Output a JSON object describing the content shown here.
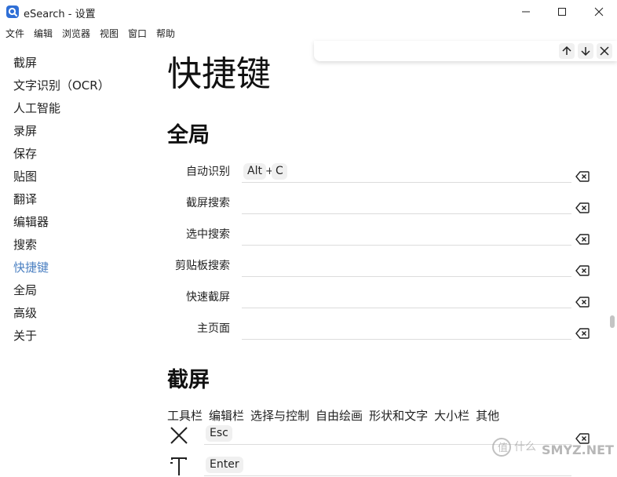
{
  "window": {
    "title": "eSearch - 设置"
  },
  "menubar": [
    "文件",
    "编辑",
    "浏览器",
    "视图",
    "窗口",
    "帮助"
  ],
  "sidebar": {
    "items": [
      "截屏",
      "文字识别（OCR）",
      "人工智能",
      "录屏",
      "保存",
      "贴图",
      "翻译",
      "编辑器",
      "搜索",
      "快捷键",
      "全局",
      "高级",
      "关于"
    ],
    "active": "快捷键"
  },
  "main": {
    "title": "快捷键",
    "global_section": {
      "title": "全局",
      "rows": [
        {
          "label": "自动识别",
          "keys": [
            "Alt",
            "C"
          ]
        },
        {
          "label": "截屏搜索",
          "keys": []
        },
        {
          "label": "选中搜索",
          "keys": []
        },
        {
          "label": "剪贴板搜索",
          "keys": []
        },
        {
          "label": "快速截屏",
          "keys": []
        },
        {
          "label": "主页面",
          "keys": []
        }
      ]
    },
    "screenshot_section": {
      "title": "截屏",
      "tabs": [
        "工具栏",
        "编辑栏",
        "选择与控制",
        "自由绘画",
        "形状和文字",
        "大小栏",
        "其他"
      ],
      "rows": [
        {
          "icon": "close-icon",
          "keys": [
            "Esc"
          ]
        },
        {
          "icon": "text-icon",
          "keys": [
            "Enter"
          ]
        }
      ]
    }
  },
  "watermark": {
    "text": "SMYZ.NET"
  },
  "accent_color": "#4a7fc1"
}
